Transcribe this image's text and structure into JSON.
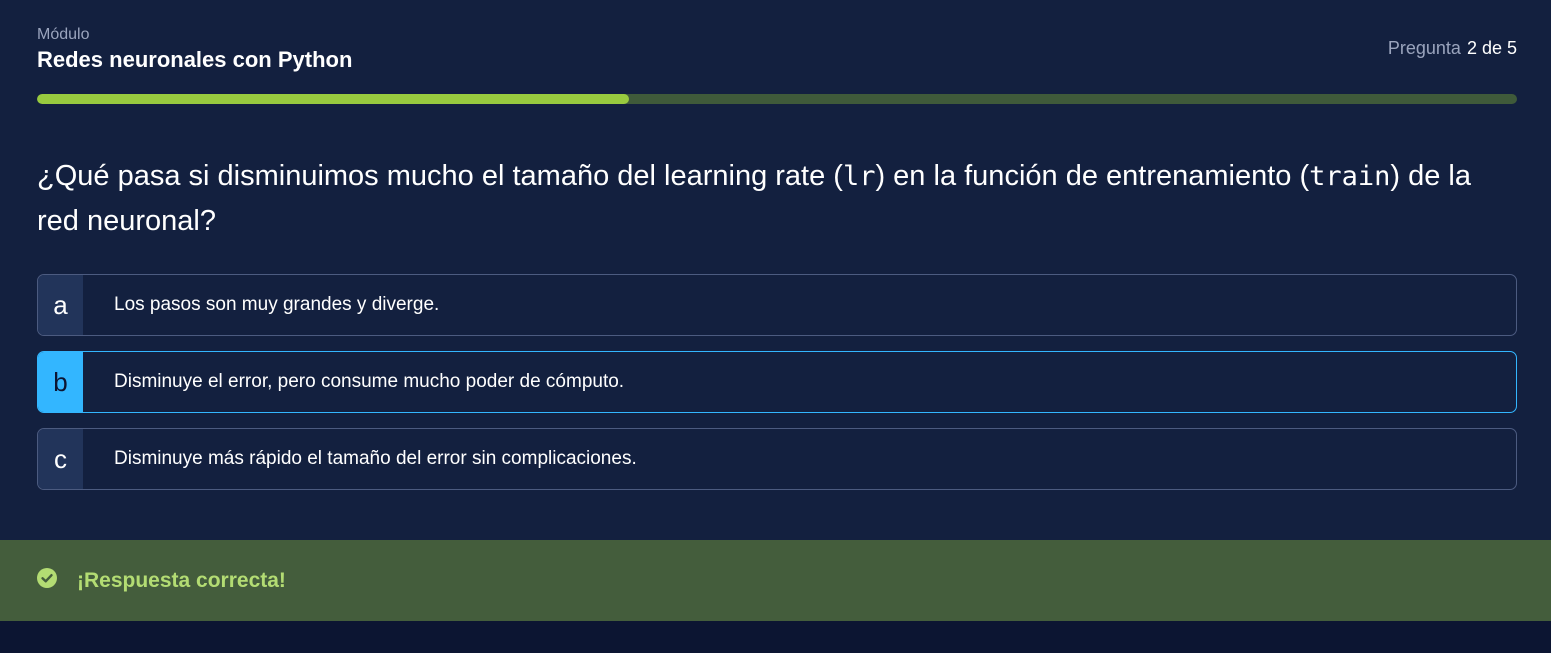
{
  "header": {
    "module_label": "Módulo",
    "module_title": "Redes neuronales con Python",
    "counter_label": "Pregunta",
    "counter_value": "2 de 5"
  },
  "progress": {
    "fraction": 0.4,
    "fill_color": "#98ca3f",
    "track_color": "#3f5a3a"
  },
  "question": {
    "part1": "¿Qué pasa si disminuimos mucho el tamaño del learning rate (",
    "code1": "lr",
    "part2": ") en la función de entrenamiento (",
    "code2": "train",
    "part3": ") de la red neuronal?"
  },
  "options": [
    {
      "letter": "a",
      "text": "Los pasos son muy grandes y diverge.",
      "selected": false
    },
    {
      "letter": "b",
      "text": "Disminuye el error, pero consume mucho poder de cómputo.",
      "selected": true
    },
    {
      "letter": "c",
      "text": "Disminuye más rápido el tamaño del error sin complicaciones.",
      "selected": false
    }
  ],
  "feedback": {
    "icon": "check-circle-icon",
    "message": "¡Respuesta correcta!",
    "color": "#b3dc73"
  },
  "colors": {
    "accent": "#33b6ff",
    "background": "#13203f",
    "success_bg": "#445d3c"
  }
}
